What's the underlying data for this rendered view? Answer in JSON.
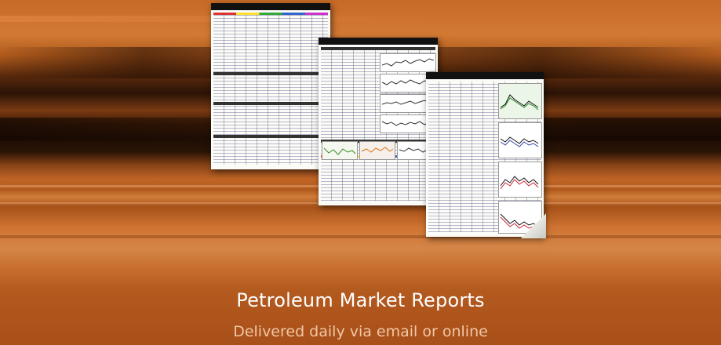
{
  "hero": {
    "title": "Petroleum Market Reports",
    "subtitle": "Delivered daily via email or online"
  },
  "colors": {
    "background": "#c35e1a",
    "title_color": "#ffffff",
    "subtitle_color": "#f0c7a6"
  },
  "icons": [
    "report-document-icon",
    "report-document-icon",
    "report-document-icon"
  ]
}
